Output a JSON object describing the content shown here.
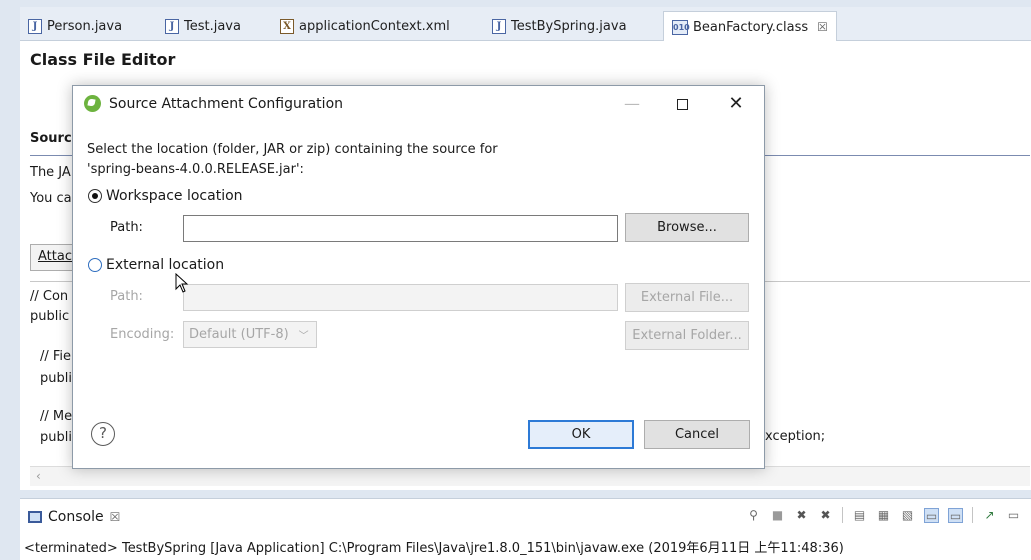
{
  "tabs": [
    {
      "label": "Person.java",
      "icon": "java-file-icon"
    },
    {
      "label": "Test.java",
      "icon": "java-file-icon"
    },
    {
      "label": "applicationContext.xml",
      "icon": "xml-file-icon"
    },
    {
      "label": "TestBySpring.java",
      "icon": "java-file-icon"
    },
    {
      "label": "BeanFactory.class",
      "icon": "class-file-icon",
      "active": true,
      "close": "☒"
    }
  ],
  "editor": {
    "title": "Class File Editor",
    "source_heading": "Sourc",
    "line1": "The JA",
    "line2": "You ca",
    "attach_button": "Attacl",
    "code": [
      "// Con",
      "public",
      "// Fie",
      "publi",
      "// Me",
      "publi"
    ],
    "code_tail": "xception;",
    "scroll_left": "‹"
  },
  "dialog": {
    "title": "Source Attachment Configuration",
    "description_line1": "Select the location (folder, JAR or zip) containing the source for",
    "description_line2": "'spring-beans-4.0.0.RELEASE.jar':",
    "workspace_label": "Workspace location",
    "workspace_selected": true,
    "path_label": "Path:",
    "path_value": "",
    "browse_button": "Browse...",
    "external_label": "External location",
    "external_selected": false,
    "ext_path_label": "Path:",
    "ext_path_value": "",
    "external_file_button": "External File...",
    "encoding_label": "Encoding:",
    "encoding_value": "Default (UTF-8)",
    "external_folder_button": "External Folder...",
    "help_symbol": "?",
    "ok_button": "OK",
    "cancel_button": "Cancel"
  },
  "console": {
    "tab_label": "Console",
    "tab_close": "☒",
    "status": "<terminated> TestBySpring [Java Application] C:\\Program Files\\Java\\jre1.8.0_151\\bin\\javaw.exe (2019年6月11日 上午11:48:36)"
  },
  "colors": {
    "accent": "#2d7ad6",
    "spring_green": "#6db33f",
    "disabled_text": "#a6a6a6"
  }
}
